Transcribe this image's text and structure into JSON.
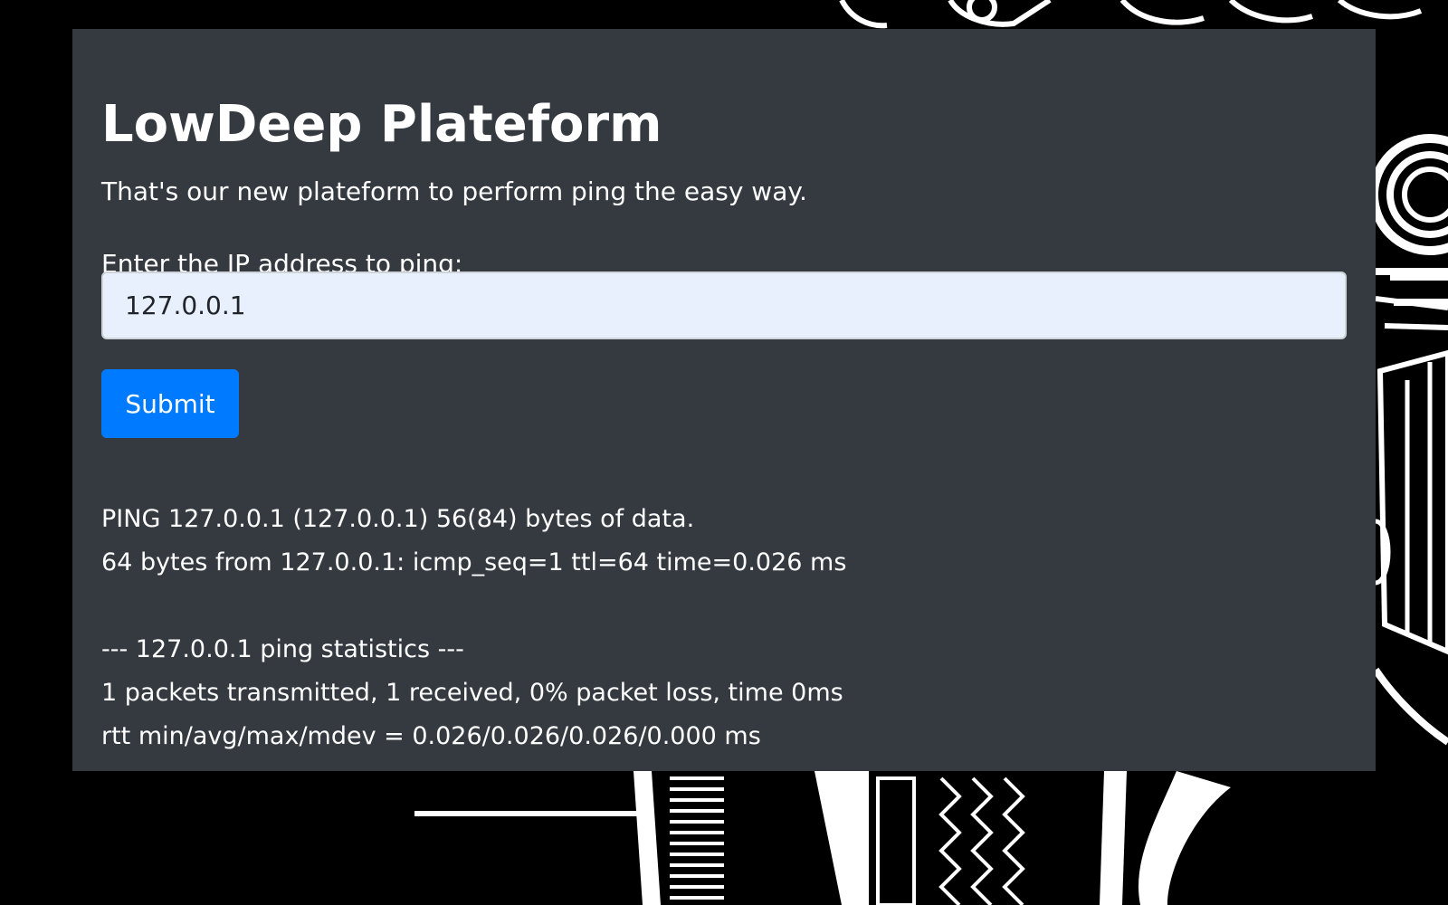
{
  "page": {
    "title": "LowDeep Plateform",
    "subtitle": "That's our new plateform to perform ping the easy way."
  },
  "form": {
    "label": "Enter the IP address to ping:",
    "ip_value": "127.0.0.1",
    "submit_label": "Submit"
  },
  "output": {
    "lines": [
      "PING 127.0.0.1 (127.0.0.1) 56(84) bytes of data.",
      "64 bytes from 127.0.0.1: icmp_seq=1 ttl=64 time=0.026 ms",
      "",
      "--- 127.0.0.1 ping statistics ---",
      "1 packets transmitted, 1 received, 0% packet loss, time 0ms",
      "rtt min/avg/max/mdev = 0.026/0.026/0.026/0.000 ms"
    ]
  },
  "colors": {
    "page_background": "#000000",
    "card_background": "#343a40",
    "input_background": "#e8f0fe",
    "button_accent": "#007bff",
    "text": "#ffffff"
  },
  "background_image": {
    "icon": "engine-illustration-icon"
  }
}
